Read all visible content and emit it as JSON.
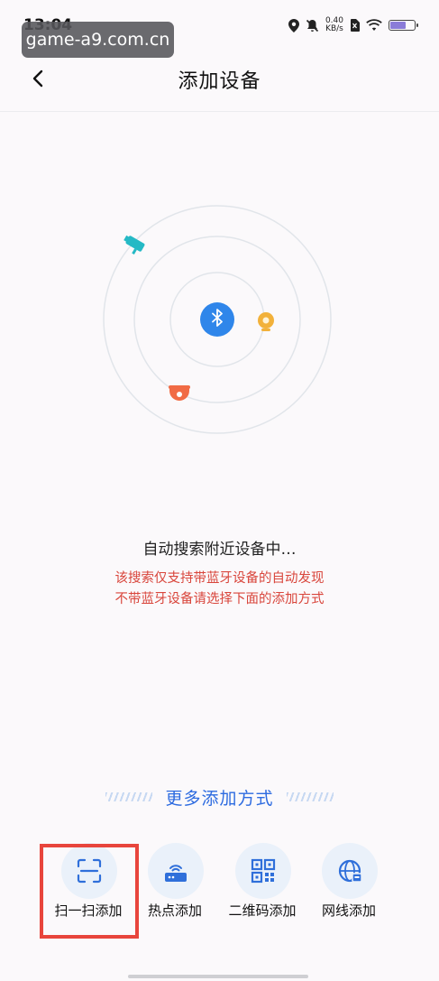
{
  "status_bar": {
    "time": "13:04",
    "net_speed_value": "0.40",
    "net_speed_unit": "KB/s",
    "icons": [
      "location-icon",
      "mute-icon",
      "sim-icon",
      "wifi-icon",
      "battery-icon"
    ]
  },
  "watermark": "game-a9.com.cn",
  "header": {
    "title": "添加设备",
    "back_icon": "back-arrow-icon"
  },
  "radar": {
    "center_icon": "bluetooth-icon",
    "devices": [
      "camera-device-icon",
      "webcam-device-icon",
      "dome-camera-device-icon"
    ],
    "colors": {
      "bluetooth": "#2f86ea",
      "camera": "#25b9c5",
      "webcam": "#f2b13a",
      "dome": "#f16b45"
    }
  },
  "status_text": "自动搜索附近设备中…",
  "notice": {
    "line1": "该搜索仅支持带蓝牙设备的自动发现",
    "line2": "不带蓝牙设备请选择下面的添加方式"
  },
  "more_methods": {
    "title": "更多添加方式",
    "items": [
      {
        "label": "扫一扫添加",
        "icon": "scan-icon"
      },
      {
        "label": "热点添加",
        "icon": "router-icon"
      },
      {
        "label": "二维码添加",
        "icon": "qrcode-icon"
      },
      {
        "label": "网线添加",
        "icon": "ethernet-globe-icon"
      }
    ]
  },
  "colors": {
    "accent": "#2d6be0",
    "warning": "#d9463c",
    "highlight": "#e8453c"
  }
}
